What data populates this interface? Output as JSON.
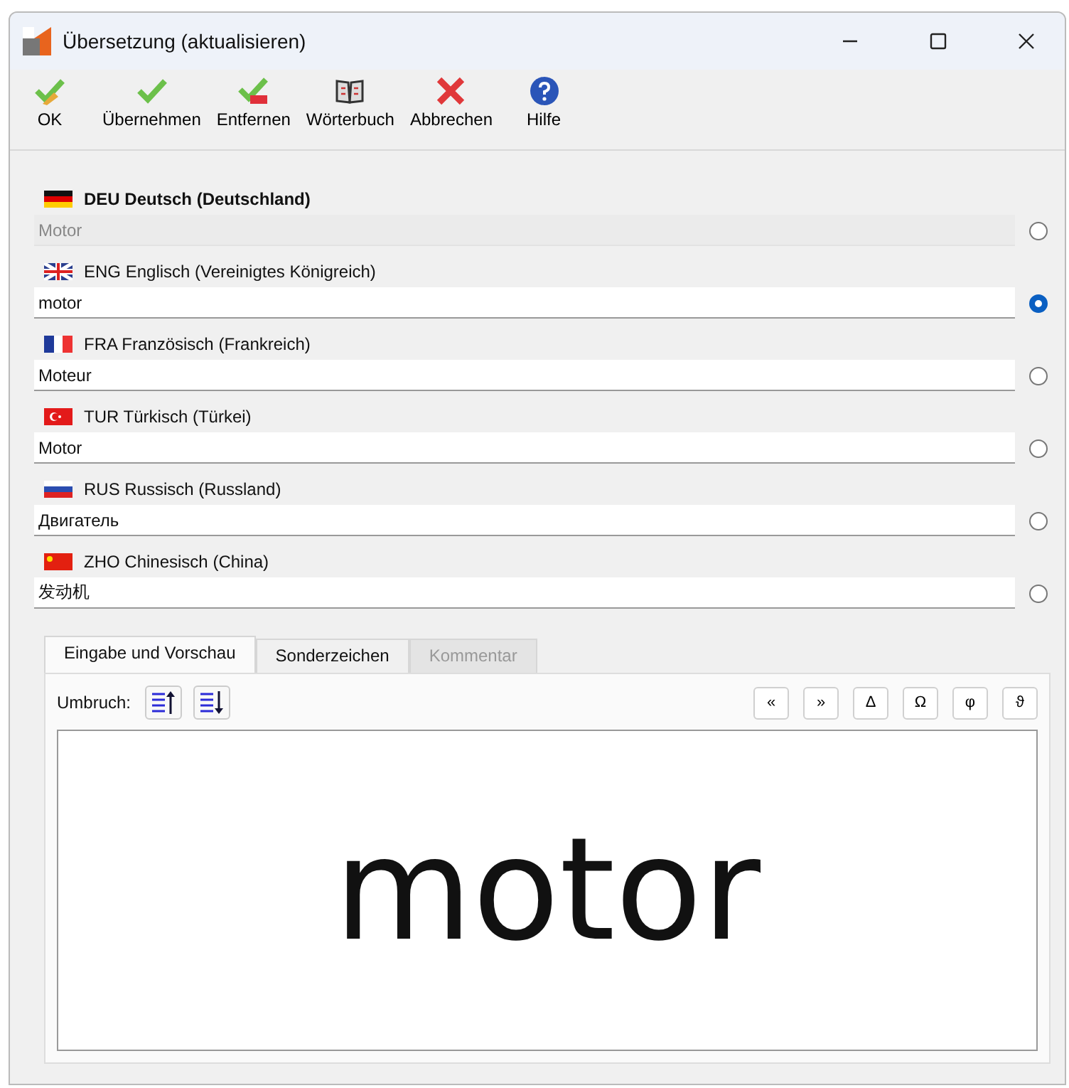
{
  "window": {
    "title": "Übersetzung (aktualisieren)"
  },
  "toolbar": [
    {
      "kind": "ok",
      "label": "OK"
    },
    {
      "kind": "apply",
      "label": "Übernehmen"
    },
    {
      "kind": "remove",
      "label": "Entfernen"
    },
    {
      "kind": "dictionary",
      "label": "Wörterbuch"
    },
    {
      "kind": "cancel",
      "label": "Abbrechen"
    },
    {
      "kind": "help",
      "label": "Hilfe"
    }
  ],
  "languages": [
    {
      "kind": "de",
      "label": "DEU Deutsch (Deutschland)",
      "value": "Motor",
      "source": true,
      "selected": false
    },
    {
      "kind": "gb",
      "label": "ENG Englisch (Vereinigtes Königreich)",
      "value": "motor",
      "source": false,
      "selected": true
    },
    {
      "kind": "fr",
      "label": "FRA Französisch (Frankreich)",
      "value": "Moteur",
      "source": false,
      "selected": false
    },
    {
      "kind": "tr",
      "label": "TUR Türkisch (Türkei)",
      "value": "Motor",
      "source": false,
      "selected": false
    },
    {
      "kind": "ru",
      "label": "RUS Russisch (Russland)",
      "value": "Двигатель",
      "source": false,
      "selected": false
    },
    {
      "kind": "cn",
      "label": "ZHO Chinesisch (China)",
      "value": "发动机",
      "source": false,
      "selected": false
    }
  ],
  "tabs": [
    {
      "label": "Eingabe und Vorschau",
      "selected": true,
      "disabled": false
    },
    {
      "label": "Sonderzeichen",
      "selected": false,
      "disabled": false
    },
    {
      "label": "Kommentar",
      "selected": false,
      "disabled": true
    }
  ],
  "wrap_label": "Umbruch:",
  "special_chars": [
    "«",
    "»",
    "Δ",
    "Ω",
    "φ",
    "ϑ"
  ],
  "preview": "motor"
}
